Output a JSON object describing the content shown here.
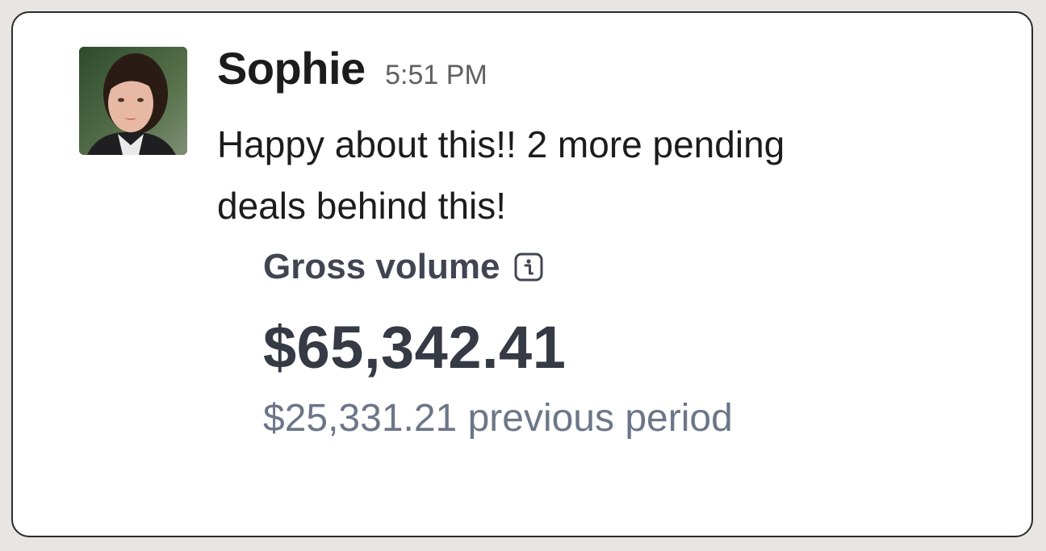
{
  "message": {
    "sender": "Sophie",
    "time": "5:51 PM",
    "text": "Happy about this!! 2 more pending deals behind this!"
  },
  "gross_volume": {
    "label": "Gross volume",
    "info_icon": "info-icon",
    "amount": "$65,342.41",
    "previous_period": "$25,331.21 previous period"
  },
  "colors": {
    "text_primary": "#1d1c1d",
    "text_secondary": "#616061",
    "metric_label": "#414552",
    "metric_amount": "#353a44",
    "metric_muted": "#6c7688",
    "card_border": "#2b2b2b"
  }
}
